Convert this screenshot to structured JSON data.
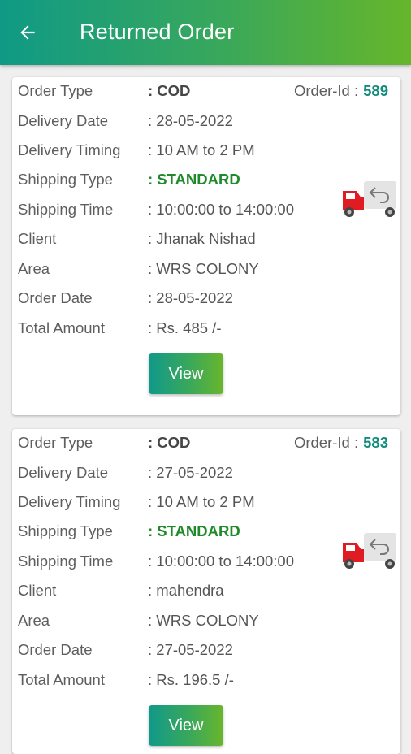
{
  "appbar": {
    "title": "Returned Order",
    "back_icon": "arrow-left-icon"
  },
  "labels": {
    "order_type": "Order Type",
    "delivery_date": "Delivery Date",
    "delivery_timing": "Delivery Timing",
    "shipping_type": "Shipping Type",
    "shipping_time": "Shipping Time",
    "client": "Client",
    "area": "Area",
    "order_date": "Order Date",
    "total_amount": "Total Amount",
    "order_id": "Order-Id :"
  },
  "orders": [
    {
      "order_type": ": COD",
      "order_id": "589",
      "delivery_date": ": 28-05-2022",
      "delivery_timing": ": 10 AM to 2 PM",
      "shipping_type": ": STANDARD",
      "shipping_time": ": 10:00:00 to 14:00:00",
      "client": ": Jhanak Nishad",
      "area": ": WRS COLONY",
      "order_date": ": 28-05-2022",
      "total_amount": ": Rs. 485 /-",
      "view_label": "View"
    },
    {
      "order_type": ": COD",
      "order_id": "583",
      "delivery_date": ": 27-05-2022",
      "delivery_timing": ": 10 AM to 2 PM",
      "shipping_type": ": STANDARD",
      "shipping_time": ": 10:00:00 to 14:00:00",
      "client": ": mahendra",
      "area": ": WRS COLONY",
      "order_date": ": 27-05-2022",
      "total_amount": ": Rs. 196.5 /-",
      "view_label": "View"
    }
  ],
  "colors": {
    "accent_start": "#0f9a86",
    "accent_end": "#66b62a",
    "order_id": "#138c7e",
    "shipping_type": "#1f8a2a",
    "truck_red": "#e01b22"
  },
  "icons": {
    "return_truck": "return-truck-icon"
  }
}
